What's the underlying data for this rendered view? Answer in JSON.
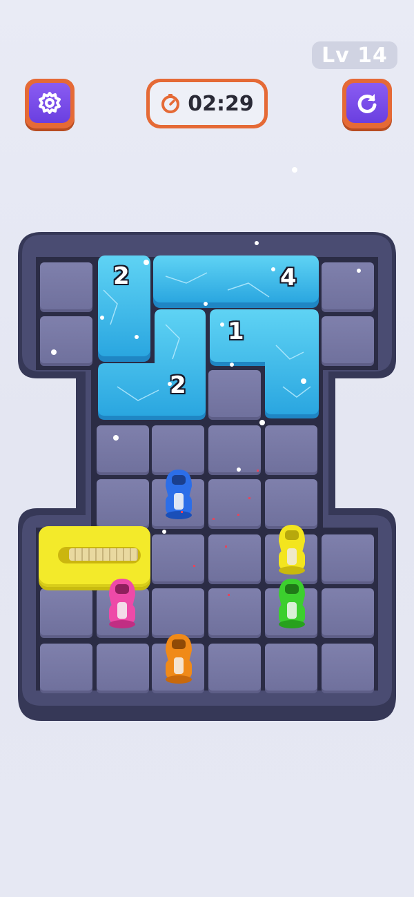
{
  "hud": {
    "level_label": "Lv 14",
    "timer_text": "02:29",
    "settings_icon": "gear-icon",
    "timer_icon": "stopwatch-icon",
    "restart_icon": "restart-icon",
    "accent_color": "#e56a36",
    "button_color": "#7a4ff0"
  },
  "board": {
    "ice_blocks": [
      {
        "name": "ice-block-left",
        "count": "2"
      },
      {
        "name": "ice-block-top",
        "count": "4"
      },
      {
        "name": "ice-block-center",
        "count": "1"
      },
      {
        "name": "ice-block-bottom-left",
        "count": "2"
      }
    ],
    "zippers": [
      {
        "name": "zipper-blue",
        "color": "#2c6ee8"
      },
      {
        "name": "zipper-yellow",
        "color": "#f3e51e"
      },
      {
        "name": "zipper-green",
        "color": "#3ccf2e"
      },
      {
        "name": "zipper-pink",
        "color": "#ee4aa8"
      },
      {
        "name": "zipper-orange",
        "color": "#f08a18"
      }
    ]
  }
}
